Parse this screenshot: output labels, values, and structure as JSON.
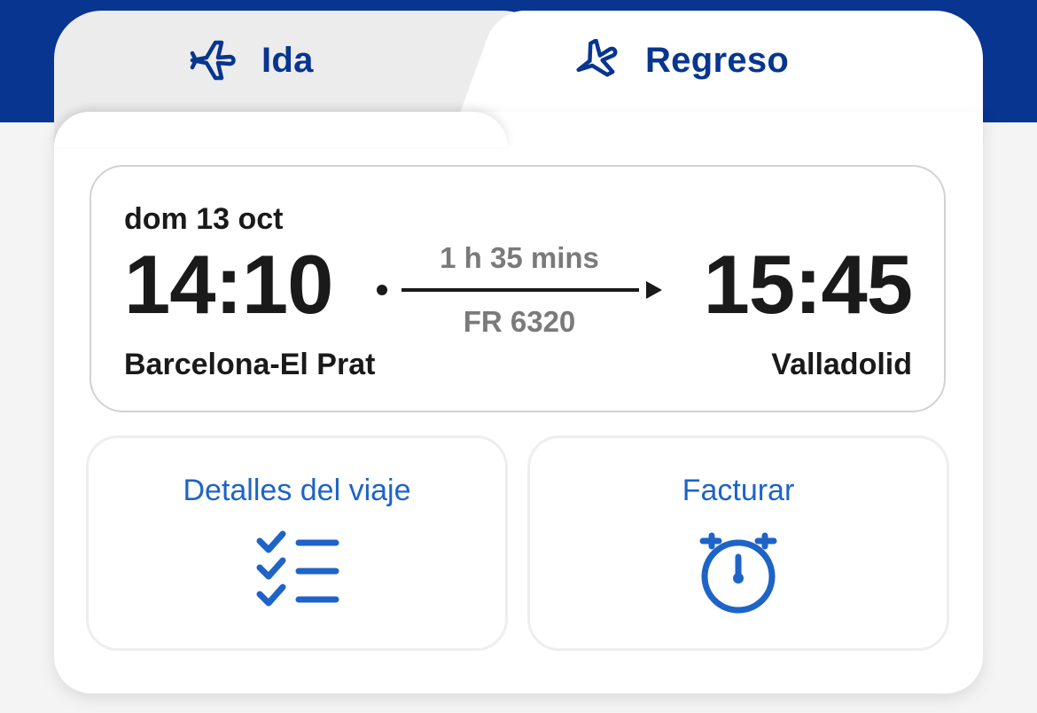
{
  "colors": {
    "brand_navy": "#073590",
    "action_blue": "#1e63c8",
    "text_dark": "#1a1a1a",
    "text_muted": "#7a7a7a"
  },
  "tabs": [
    {
      "label": "Ida",
      "icon": "airplane-icon",
      "selected": false
    },
    {
      "label": "Regreso",
      "icon": "airplane-icon",
      "selected": true
    }
  ],
  "flight": {
    "date": "dom 13 oct",
    "departure_time": "14:10",
    "arrival_time": "15:45",
    "duration": "1 h 35 mins",
    "flight_number": "FR 6320",
    "origin": "Barcelona-El Prat",
    "destination": "Valladolid"
  },
  "actions": [
    {
      "label": "Detalles del viaje",
      "icon": "checklist-icon"
    },
    {
      "label": "Facturar",
      "icon": "stopwatch-icon"
    }
  ]
}
